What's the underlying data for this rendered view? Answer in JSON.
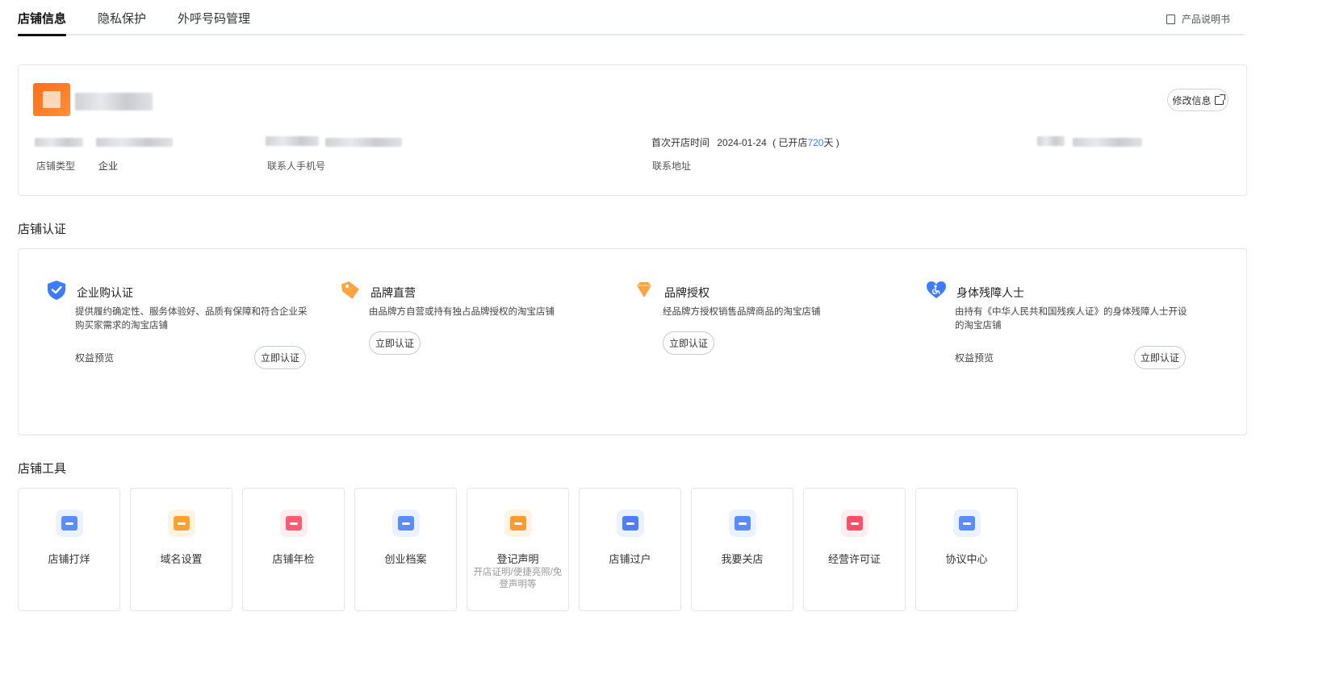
{
  "tabs": [
    {
      "label": "店铺信息",
      "active": true
    },
    {
      "label": "隐私保护",
      "active": false
    },
    {
      "label": "外呼号码管理",
      "active": false
    }
  ],
  "manual_link": "产品说明书",
  "shop_info": {
    "edit_button": "修改信息",
    "fields": {
      "shop_type_label": "店铺类型",
      "shop_type_value": "企业",
      "contact_phone_label": "联系人手机号",
      "first_open_label": "首次开店时间",
      "first_open_date": "2024-01-24",
      "opened_prefix": "( 已开店",
      "opened_days": "720",
      "opened_suffix": "天 )",
      "contact_address_label": "联系地址"
    }
  },
  "certification": {
    "title": "店铺认证",
    "items": [
      {
        "icon": "shield-check-icon",
        "title": "企业购认证",
        "desc": "提供履约确定性、服务体验好、品质有保障和符合企业采购买家需求的淘宝店铺",
        "rights": "权益预览",
        "button": "立即认证",
        "color": "#3d7bff"
      },
      {
        "icon": "tag-icon",
        "title": "品牌直营",
        "desc": "由品牌方自营或持有独占品牌授权的淘宝店铺",
        "button": "立即认证",
        "color": "#ff9a2e"
      },
      {
        "icon": "diamond-icon",
        "title": "品牌授权",
        "desc": "经品牌方授权销售品牌商品的淘宝店铺",
        "button": "立即认证",
        "color": "#ff9a2e"
      },
      {
        "icon": "heart-accessibility-icon",
        "title": "身体残障人士",
        "desc": "由持有《中华人民共和国残疾人证》的身体残障人士开设的淘宝店铺",
        "rights": "权益预览",
        "button": "立即认证",
        "color": "#3d7bff"
      }
    ]
  },
  "tools": {
    "title": "店铺工具",
    "items": [
      {
        "label": "店铺打烊",
        "icon": "store-closed-icon",
        "color": "#5b8cff",
        "bg": "#eaf1ff"
      },
      {
        "label": "域名设置",
        "icon": "domain-icon",
        "color": "#ffa12e",
        "bg": "#fff3e4"
      },
      {
        "label": "店铺年检",
        "icon": "shield-search-icon",
        "color": "#ff5b73",
        "bg": "#ffeef0"
      },
      {
        "label": "创业档案",
        "icon": "file-check-icon",
        "color": "#5b8cff",
        "bg": "#eaf1ff"
      },
      {
        "label": "登记声明",
        "sub": "开店证明/便捷亮照/免登声明等",
        "icon": "certificate-icon",
        "color": "#ff9a2e",
        "bg": "#fff3e4"
      },
      {
        "label": "店铺过户",
        "icon": "transfer-icon",
        "color": "#4f7dff",
        "bg": "#eaf1ff"
      },
      {
        "label": "我要关店",
        "icon": "close-store-icon",
        "color": "#5b8cff",
        "bg": "#eaf1ff"
      },
      {
        "label": "经营许可证",
        "icon": "license-icon",
        "color": "#ff4d6a",
        "bg": "#ffeef0"
      },
      {
        "label": "协议中心",
        "icon": "agreement-icon",
        "color": "#5b8cff",
        "bg": "#eaf1ff"
      }
    ]
  }
}
